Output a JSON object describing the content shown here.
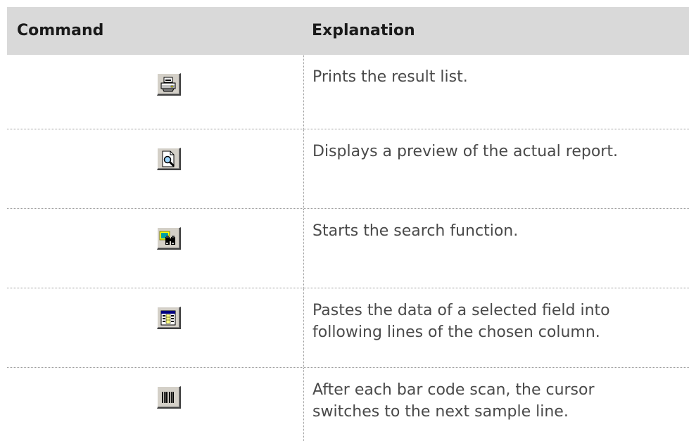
{
  "header": {
    "command": "Command",
    "explanation": "Explanation"
  },
  "rows": [
    {
      "icon": "printer-icon",
      "lines": [
        "Prints the result list."
      ]
    },
    {
      "icon": "print-preview-icon",
      "lines": [
        "Displays a preview of the actual report."
      ]
    },
    {
      "icon": "search-binoculars-icon",
      "lines": [
        "Starts the search function."
      ]
    },
    {
      "icon": "fill-column-icon",
      "lines": [
        "Pastes the data of a selected field into",
        "following lines of the chosen column."
      ]
    },
    {
      "icon": "barcode-icon",
      "lines": [
        "After each bar code scan, the cursor",
        "switches to the next sample line."
      ]
    }
  ],
  "colors": {
    "header_bg": "#d9d9d9",
    "text": "#4a4a4a",
    "button_face": "#d4d0c8"
  }
}
